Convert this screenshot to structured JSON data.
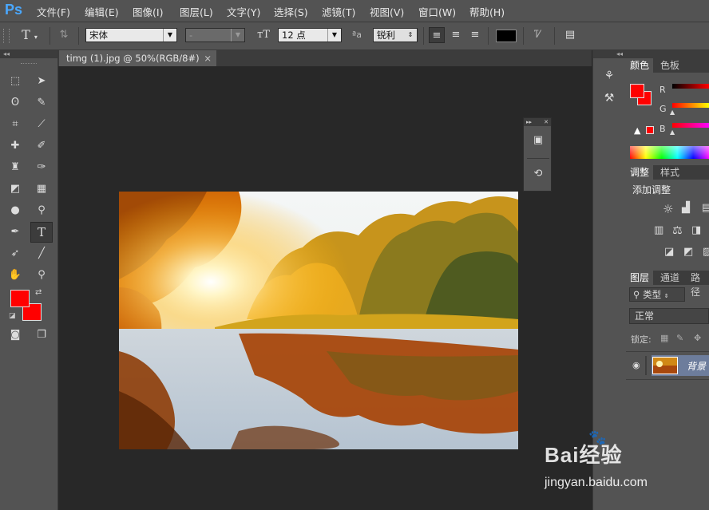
{
  "app": {
    "logo": "Ps"
  },
  "menu": [
    "文件(F)",
    "编辑(E)",
    "图像(I)",
    "图层(L)",
    "文字(Y)",
    "选择(S)",
    "滤镜(T)",
    "视图(V)",
    "窗口(W)",
    "帮助(H)"
  ],
  "options": {
    "font_family": "宋体",
    "font_style": "-",
    "font_size": "12 点",
    "aa_label": "ªa",
    "antialias": "锐利",
    "text_color": "#000000"
  },
  "document": {
    "tab_title": "timg (1).jpg @ 50%(RGB/8#)",
    "close": "×"
  },
  "colors": {
    "foreground": "#ff0000",
    "background": "#ff0000",
    "accent": "#e8e8e8"
  },
  "panels": {
    "color": {
      "tabs": [
        "颜色",
        "色板"
      ],
      "channels": [
        "R",
        "G",
        "B"
      ]
    },
    "adjust": {
      "tabs": [
        "调整",
        "样式"
      ],
      "title": "添加调整"
    },
    "layers": {
      "tabs": [
        "图层",
        "通道",
        "路径"
      ],
      "filter_label": "类型",
      "blend_mode": "正常",
      "lock_label": "锁定:",
      "layer_name": "背景"
    }
  },
  "watermark": {
    "brand": "Bai经验",
    "url": "jingyan.baidu.com"
  }
}
